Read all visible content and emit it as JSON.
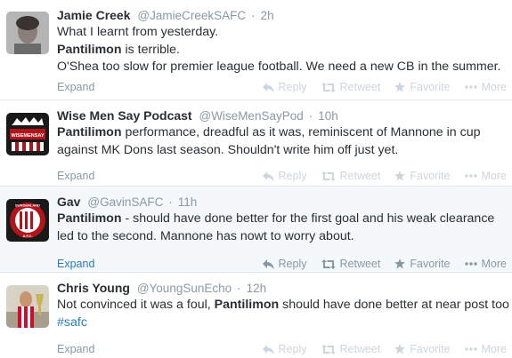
{
  "tweets": [
    {
      "fullname": "Jamie Creek",
      "username": "@JamieCreekSAFC",
      "time": "2h",
      "lines": [
        [
          {
            "t": "What I learnt from yesterday.",
            "b": false
          }
        ],
        [
          {
            "t": "Pantilimon",
            "b": true
          },
          {
            "t": " is terrible.",
            "b": false
          }
        ],
        [
          {
            "t": "O'Shea too slow for premier league football. We need a new CB in the summer.",
            "b": false
          }
        ]
      ],
      "expand": "Expand"
    },
    {
      "fullname": "Wise Men Say Podcast",
      "username": "@WiseMenSayPod",
      "time": "10h",
      "avatar_text": "WISEMENSAY",
      "lines": [
        [
          {
            "t": "Pantilimon",
            "b": true
          },
          {
            "t": " performance, dreadful as it was, reminiscent of Mannone in cup",
            "b": false
          }
        ],
        [
          {
            "t": "against MK Dons last season. Shouldn't write him off just yet.",
            "b": false
          }
        ]
      ],
      "expand": "Expand"
    },
    {
      "fullname": "Gav",
      "username": "@GavinSAFC",
      "time": "11h",
      "avatar_text_top": "SUNDERLAND",
      "avatar_text_bottom": "A.F.C.",
      "lines": [
        [
          {
            "t": "Pantilimon",
            "b": true
          },
          {
            "t": " - should have done better for the first goal and his weak clearance",
            "b": false
          }
        ],
        [
          {
            "t": "led to the second. Mannone has nowt to worry about.",
            "b": false
          }
        ]
      ],
      "expand": "Expand"
    },
    {
      "fullname": "Chris Young",
      "username": "@YoungSunEcho",
      "time": "12h",
      "lines": [
        [
          {
            "t": "Not convinced it was a foul, ",
            "b": false
          },
          {
            "t": "Pantilimon",
            "b": true
          },
          {
            "t": " should have done better at near post too",
            "b": false
          }
        ],
        [
          {
            "t": "#safc",
            "b": false,
            "tag": true
          }
        ]
      ],
      "expand": "Expand"
    }
  ],
  "actions": {
    "reply": "Reply",
    "retweet": "Retweet",
    "favorite": "Favorite",
    "more": "More"
  },
  "colors": {
    "accent": "#2b7bb9",
    "muted": "#8899a6",
    "text": "#292f33",
    "hover_bg": "#f5f8fa"
  },
  "separator": "·"
}
